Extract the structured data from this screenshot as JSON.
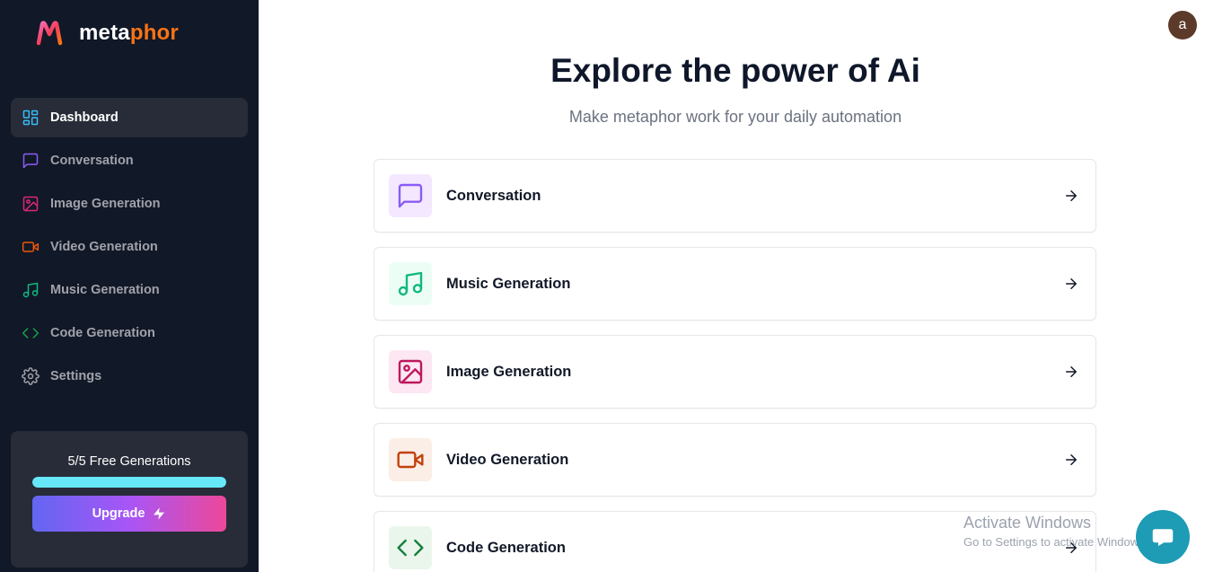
{
  "app": {
    "logo_part1": "meta",
    "logo_part2": "phor"
  },
  "sidebar": {
    "items": [
      {
        "label": "Dashboard",
        "icon": "layout-dashboard-icon",
        "color": "#38bdf8"
      },
      {
        "label": "Conversation",
        "icon": "message-square-icon",
        "color": "#8b5cf6"
      },
      {
        "label": "Image Generation",
        "icon": "image-icon",
        "color": "#db2777"
      },
      {
        "label": "Video Generation",
        "icon": "video-icon",
        "color": "#ea580c"
      },
      {
        "label": "Music Generation",
        "icon": "music-icon",
        "color": "#10b981"
      },
      {
        "label": "Code Generation",
        "icon": "code-icon",
        "color": "#16a34a"
      },
      {
        "label": "Settings",
        "icon": "settings-icon",
        "color": "#a1a1aa"
      }
    ],
    "free_generations": {
      "text": "5/5 Free Generations",
      "progress_percent": 100
    },
    "upgrade_label": "Upgrade"
  },
  "header": {
    "avatar_letter": "a"
  },
  "main": {
    "title": "Explore the power of Ai",
    "subtitle": "Make metaphor work for your daily automation",
    "tools": [
      {
        "label": "Conversation",
        "icon": "message-square-icon",
        "color": "#8b5cf6",
        "bg": "#f3e8ff"
      },
      {
        "label": "Music Generation",
        "icon": "music-icon",
        "color": "#10b981",
        "bg": "#ecfdf5"
      },
      {
        "label": "Image Generation",
        "icon": "image-icon",
        "color": "#be185d",
        "bg": "#fce7f3"
      },
      {
        "label": "Video Generation",
        "icon": "video-icon",
        "color": "#c2410c",
        "bg": "#fbeee6"
      },
      {
        "label": "Code Generation",
        "icon": "code-icon",
        "color": "#15803d",
        "bg": "#eaf6ec"
      }
    ]
  },
  "watermark": {
    "title": "Activate Windows",
    "subtitle": "Go to Settings to activate Windows."
  },
  "chat_widget": {
    "icon": "chat-icon",
    "color": "#1e9bb5"
  }
}
